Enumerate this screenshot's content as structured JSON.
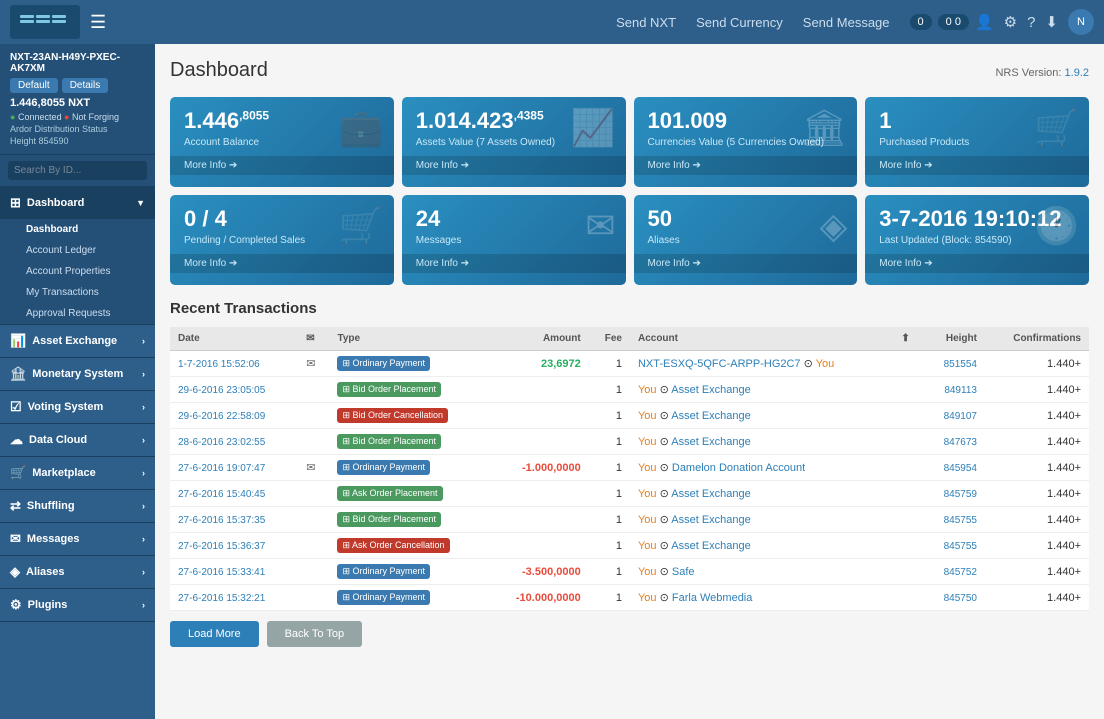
{
  "topnav": {
    "send_nxt": "Send NXT",
    "send_currency": "Send Currency",
    "send_message": "Send Message",
    "badge1": "0",
    "badge2": "0 0"
  },
  "sidebar": {
    "account_id": "NXT-23AN-H49Y-PXEC-AK7XM",
    "btn_default": "Default",
    "btn_details": "Details",
    "balance": "1.446,8055 NXT",
    "connected": "Connected",
    "not_forging": "Not Forging",
    "ardor": "Ardor Distribution Status",
    "height": "Height 854590",
    "search_placeholder": "Search By ID...",
    "nav": [
      {
        "id": "dashboard",
        "label": "Dashboard",
        "icon": "⊞",
        "expanded": true,
        "sub": [
          {
            "id": "dashboard-main",
            "label": "Dashboard",
            "active": true
          },
          {
            "id": "account-ledger",
            "label": "Account Ledger"
          },
          {
            "id": "account-properties",
            "label": "Account Properties"
          },
          {
            "id": "my-transactions",
            "label": "My Transactions"
          },
          {
            "id": "approval-requests",
            "label": "Approval Requests"
          }
        ]
      },
      {
        "id": "asset-exchange",
        "label": "Asset Exchange",
        "icon": "📊",
        "expanded": false,
        "sub": []
      },
      {
        "id": "monetary-system",
        "label": "Monetary System",
        "icon": "🏦",
        "expanded": false,
        "sub": []
      },
      {
        "id": "voting-system",
        "label": "Voting System",
        "icon": "☑",
        "expanded": false,
        "sub": []
      },
      {
        "id": "data-cloud",
        "label": "Data Cloud",
        "icon": "☁",
        "expanded": false,
        "sub": []
      },
      {
        "id": "marketplace",
        "label": "Marketplace",
        "icon": "🛒",
        "expanded": false,
        "sub": []
      },
      {
        "id": "shuffling",
        "label": "Shuffling",
        "icon": "⇄",
        "expanded": false,
        "sub": []
      },
      {
        "id": "messages",
        "label": "Messages",
        "icon": "✉",
        "expanded": false,
        "sub": []
      },
      {
        "id": "aliases",
        "label": "Aliases",
        "icon": "◈",
        "expanded": false,
        "sub": []
      },
      {
        "id": "plugins",
        "label": "Plugins",
        "icon": "⚙",
        "expanded": false,
        "sub": []
      }
    ]
  },
  "dashboard": {
    "title": "Dashboard",
    "nrs_label": "NRS Version:",
    "nrs_version": "1.9.2",
    "cards": [
      {
        "value": "1.446",
        "sup": ",8055",
        "label": "Account Balance",
        "footer": "More Info ➔",
        "icon": "💼"
      },
      {
        "value": "1.014.423",
        "sup": ",4385",
        "label": "Assets Value (7 Assets Owned)",
        "footer": "More Info ➔",
        "icon": "📈"
      },
      {
        "value": "101.009",
        "sup": "",
        "label": "Currencies Value (5 Currencies Owned)",
        "footer": "More Info ➔",
        "icon": "🏛"
      },
      {
        "value": "1",
        "sup": "",
        "label": "Purchased Products",
        "footer": "More Info ➔",
        "icon": "🛒"
      },
      {
        "value": "0 / 4",
        "sup": "",
        "label": "Pending / Completed Sales",
        "footer": "More Info ➔",
        "icon": "🛒"
      },
      {
        "value": "24",
        "sup": "",
        "label": "Messages",
        "footer": "More Info ➔",
        "icon": "✉"
      },
      {
        "value": "50",
        "sup": "",
        "label": "Aliases",
        "footer": "More Info ➔",
        "icon": "◈"
      },
      {
        "value": "3-7-2016 19:10:12",
        "sup": "",
        "label": "Last Updated (Block: 854590)",
        "footer": "More Info ➔",
        "icon": "🕐"
      }
    ],
    "transactions_title": "Recent Transactions",
    "table_headers": [
      "Date",
      "",
      "Type",
      "Amount",
      "Fee",
      "Account",
      "",
      "Height",
      "Confirmations"
    ],
    "transactions": [
      {
        "date": "1-7-2016 15:52:06",
        "has_msg": true,
        "type": "Ordinary Payment",
        "type_color": "blue",
        "amount": "23,6972",
        "amount_class": "pos",
        "fee": "1",
        "account": "NXT-ESXQ-5QFC-ARPP-HG2C7",
        "account_suffix": "You",
        "height": "851554",
        "confirmations": "1.440+"
      },
      {
        "date": "29-6-2016 23:05:05",
        "has_msg": false,
        "type": "Bid Order Placement",
        "type_color": "green",
        "amount": "",
        "amount_class": "",
        "fee": "1",
        "account": "You",
        "account_suffix": "Asset Exchange",
        "height": "849113",
        "confirmations": "1.440+"
      },
      {
        "date": "29-6-2016 22:58:09",
        "has_msg": false,
        "type": "Bid Order Cancellation",
        "type_color": "red",
        "amount": "",
        "amount_class": "",
        "fee": "1",
        "account": "You",
        "account_suffix": "Asset Exchange",
        "height": "849107",
        "confirmations": "1.440+"
      },
      {
        "date": "28-6-2016 23:02:55",
        "has_msg": false,
        "type": "Bid Order Placement",
        "type_color": "green",
        "amount": "",
        "amount_class": "",
        "fee": "1",
        "account": "You",
        "account_suffix": "Asset Exchange",
        "height": "847673",
        "confirmations": "1.440+"
      },
      {
        "date": "27-6-2016 19:07:47",
        "has_msg": true,
        "type": "Ordinary Payment",
        "type_color": "blue",
        "amount": "-1.000,0000",
        "amount_class": "neg",
        "fee": "1",
        "account": "You",
        "account_suffix": "Damelon Donation Account",
        "height": "845954",
        "confirmations": "1.440+"
      },
      {
        "date": "27-6-2016 15:40:45",
        "has_msg": false,
        "type": "Ask Order Placement",
        "type_color": "green",
        "amount": "",
        "amount_class": "",
        "fee": "1",
        "account": "You",
        "account_suffix": "Asset Exchange",
        "height": "845759",
        "confirmations": "1.440+"
      },
      {
        "date": "27-6-2016 15:37:35",
        "has_msg": false,
        "type": "Bid Order Placement",
        "type_color": "green",
        "amount": "",
        "amount_class": "",
        "fee": "1",
        "account": "You",
        "account_suffix": "Asset Exchange",
        "height": "845755",
        "confirmations": "1.440+"
      },
      {
        "date": "27-6-2016 15:36:37",
        "has_msg": false,
        "type": "Ask Order Cancellation",
        "type_color": "red",
        "amount": "",
        "amount_class": "",
        "fee": "1",
        "account": "You",
        "account_suffix": "Asset Exchange",
        "height": "845755",
        "confirmations": "1.440+"
      },
      {
        "date": "27-6-2016 15:33:41",
        "has_msg": false,
        "type": "Ordinary Payment",
        "type_color": "blue",
        "amount": "-3.500,0000",
        "amount_class": "neg",
        "fee": "1",
        "account": "You",
        "account_suffix": "Safe",
        "height": "845752",
        "confirmations": "1.440+"
      },
      {
        "date": "27-6-2016 15:32:21",
        "has_msg": false,
        "type": "Ordinary Payment",
        "type_color": "blue",
        "amount": "-10.000,0000",
        "amount_class": "neg",
        "fee": "1",
        "account": "You",
        "account_suffix": "Farla Webmedia",
        "height": "845750",
        "confirmations": "1.440+"
      }
    ],
    "btn_load_more": "Load More",
    "btn_back_to_top": "Back To Top"
  }
}
